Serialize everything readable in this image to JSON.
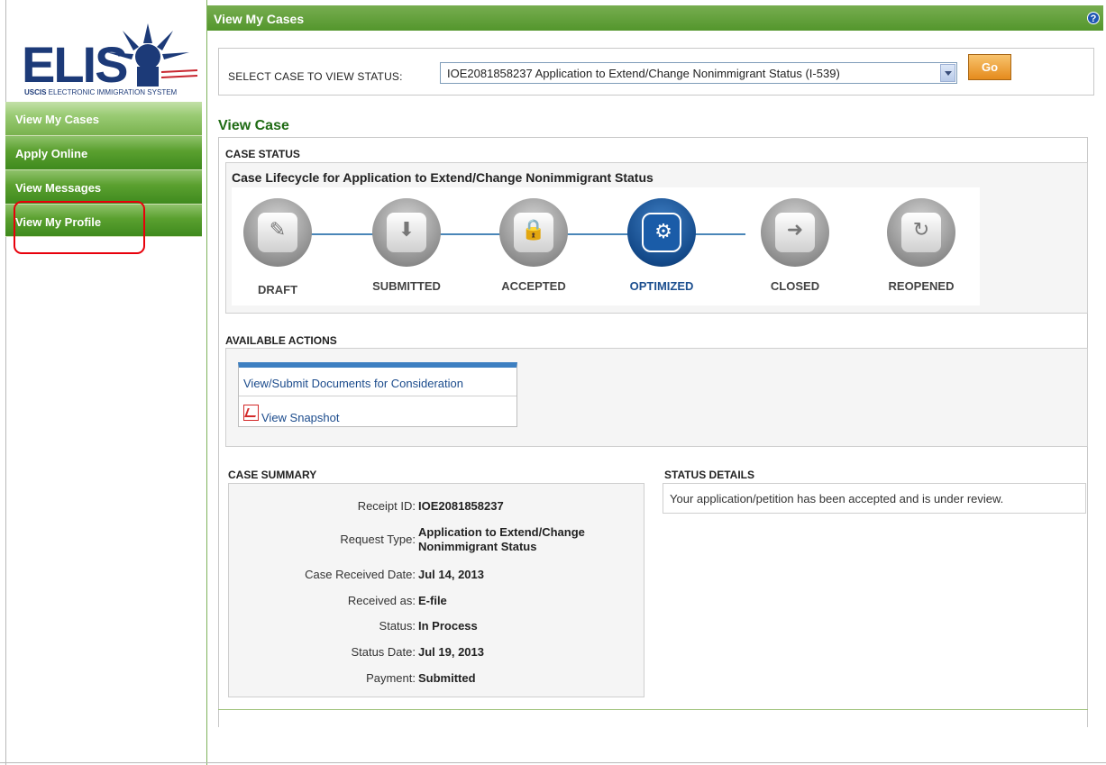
{
  "logo": {
    "text": "ELIS",
    "sub_bold": "USCIS",
    "sub": " ELECTRONIC IMMIGRATION SYSTEM"
  },
  "nav": {
    "items": [
      {
        "label": "View My Cases"
      },
      {
        "label": "Apply Online"
      },
      {
        "label": "View Messages"
      },
      {
        "label": "View My Profile"
      }
    ]
  },
  "header": {
    "title": "View My Cases",
    "help": "?"
  },
  "select_case": {
    "label": "SELECT CASE TO VIEW STATUS:",
    "value": "IOE2081858237 Application to Extend/Change Nonimmigrant Status (I-539)",
    "go_label": "Go"
  },
  "view_case": {
    "title": "View Case"
  },
  "case_status": {
    "heading": "CASE STATUS",
    "lifecycle_title": "Case Lifecycle for Application to Extend/Change Nonimmigrant Status",
    "stages": [
      {
        "label": "DRAFT",
        "icon": "document-icon",
        "glyph": "✎"
      },
      {
        "label": "SUBMITTED",
        "icon": "download-icon",
        "glyph": "⬇"
      },
      {
        "label": "ACCEPTED",
        "icon": "lock-icon",
        "glyph": "🔒"
      },
      {
        "label": "OPTIMIZED",
        "icon": "gears-icon",
        "glyph": "⚙"
      },
      {
        "label": "CLOSED",
        "icon": "folder-arrow-icon",
        "glyph": "➜"
      },
      {
        "label": "REOPENED",
        "icon": "folder-open-icon",
        "glyph": "↻"
      }
    ],
    "current_stage": "OPTIMIZED"
  },
  "actions": {
    "heading": "AVAILABLE ACTIONS",
    "view_submit": "View/Submit Documents for Consideration",
    "snapshot": "View Snapshot"
  },
  "summary": {
    "heading": "CASE SUMMARY",
    "rows": [
      {
        "label": "Receipt ID:",
        "value": "IOE2081858237"
      },
      {
        "label": "Request Type:",
        "value": "Application to Extend/Change",
        "value2": "Nonimmigrant Status"
      },
      {
        "label": "Case Received Date:",
        "value": "Jul 14, 2013"
      },
      {
        "label": "Received as:",
        "value": "E-file"
      },
      {
        "label": "Status:",
        "value": "In Process"
      },
      {
        "label": "Status Date:",
        "value": "Jul 19, 2013"
      },
      {
        "label": "Payment:",
        "value": "Submitted"
      }
    ]
  },
  "status_details": {
    "heading": "STATUS DETAILS",
    "text": "Your application/petition has been accepted and is under review."
  },
  "colors": {
    "nav_green": "#4f9527",
    "brand_blue": "#1c3a78",
    "highlight_red": "#e8000b",
    "current_stage": "#1c4f8f"
  }
}
